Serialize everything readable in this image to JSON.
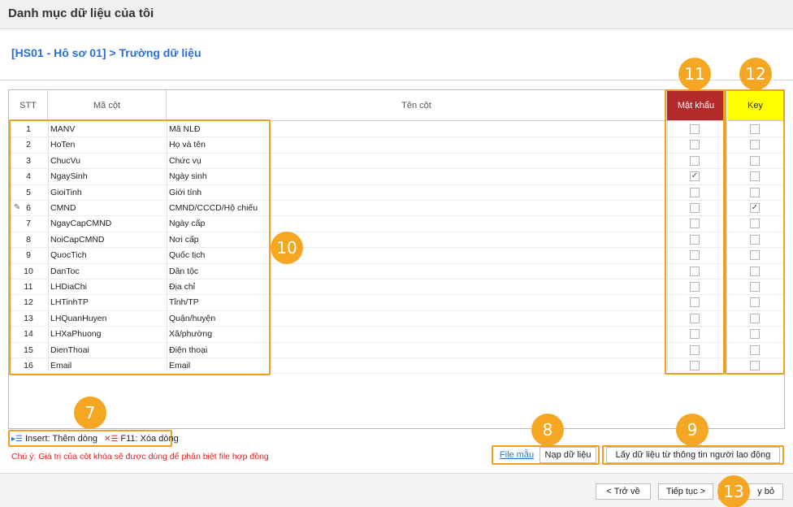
{
  "window": {
    "title": "Danh mục dữ liệu của tôi"
  },
  "breadcrumb": "[HS01 - Hô sơ 01] > Trường dữ liệu",
  "grid": {
    "columns": {
      "stt": "STT",
      "ma_cot": "Mã cột",
      "ten_cot": "Tên cột",
      "mat_khau": "Mật khẩu",
      "key": "Key"
    },
    "rows": [
      {
        "stt": "1",
        "ma": "MANV",
        "ten": "Mã NLĐ",
        "mat_khau": false,
        "key": false
      },
      {
        "stt": "2",
        "ma": "HoTen",
        "ten": "Họ và tên",
        "mat_khau": false,
        "key": false
      },
      {
        "stt": "3",
        "ma": "ChucVu",
        "ten": "Chức vụ",
        "mat_khau": false,
        "key": false
      },
      {
        "stt": "4",
        "ma": "NgaySinh",
        "ten": "Ngày sinh",
        "mat_khau": true,
        "key": false
      },
      {
        "stt": "5",
        "ma": "GioiTinh",
        "ten": "Giới tính",
        "mat_khau": false,
        "key": false
      },
      {
        "stt": "6",
        "ma": "CMND",
        "ten": "CMND/CCCD/Hộ chiếu",
        "mat_khau": false,
        "key": true,
        "editing": true
      },
      {
        "stt": "7",
        "ma": "NgayCapCMND",
        "ten": "Ngày cấp",
        "mat_khau": false,
        "key": false
      },
      {
        "stt": "8",
        "ma": "NoiCapCMND",
        "ten": "Nơi cấp",
        "mat_khau": false,
        "key": false
      },
      {
        "stt": "9",
        "ma": "QuocTich",
        "ten": "Quốc tịch",
        "mat_khau": false,
        "key": false
      },
      {
        "stt": "10",
        "ma": "DanToc",
        "ten": "Dân tộc",
        "mat_khau": false,
        "key": false
      },
      {
        "stt": "11",
        "ma": "LHDiaChi",
        "ten": "Địa chỉ",
        "mat_khau": false,
        "key": false
      },
      {
        "stt": "12",
        "ma": "LHTinhTP",
        "ten": "Tỉnh/TP",
        "mat_khau": false,
        "key": false
      },
      {
        "stt": "13",
        "ma": "LHQuanHuyen",
        "ten": "Quận/huyện",
        "mat_khau": false,
        "key": false
      },
      {
        "stt": "14",
        "ma": "LHXaPhuong",
        "ten": "Xã/phường",
        "mat_khau": false,
        "key": false
      },
      {
        "stt": "15",
        "ma": "DienThoai",
        "ten": "Điện thoại",
        "mat_khau": false,
        "key": false
      },
      {
        "stt": "16",
        "ma": "Email",
        "ten": "Email",
        "mat_khau": false,
        "key": false
      }
    ]
  },
  "legend": {
    "insert": "Insert: Thêm dòng",
    "delete": "F11: Xóa dòng"
  },
  "note": "Chú ý: Giá trị của cột khóa sẽ được dùng để phân biệt file hợp đồng",
  "buttons": {
    "file_mau": "File mẫu",
    "nap_du_lieu": "Nạp dữ liệu",
    "lay_du_lieu": "Lấy dữ liệu từ thông tin người lao động",
    "tro_ve": "< Trở về",
    "tiep_tuc": "Tiếp tục >",
    "huy_bo": "Hủy bỏ",
    "huy_bo_visible": "y bỏ"
  },
  "badges": {
    "b7": "7",
    "b8": "8",
    "b9": "9",
    "b10": "10",
    "b11": "11",
    "b12": "12",
    "b13": "13"
  },
  "icons": {
    "edit_row": "pencil-icon",
    "insert": "insert-row-icon",
    "delete": "delete-row-icon"
  },
  "colors": {
    "accent": "#f5a623",
    "mat_khau_header": "#b22a2a",
    "key_header": "#ffff00",
    "link": "#2a6fd6",
    "note": "#e02020"
  }
}
